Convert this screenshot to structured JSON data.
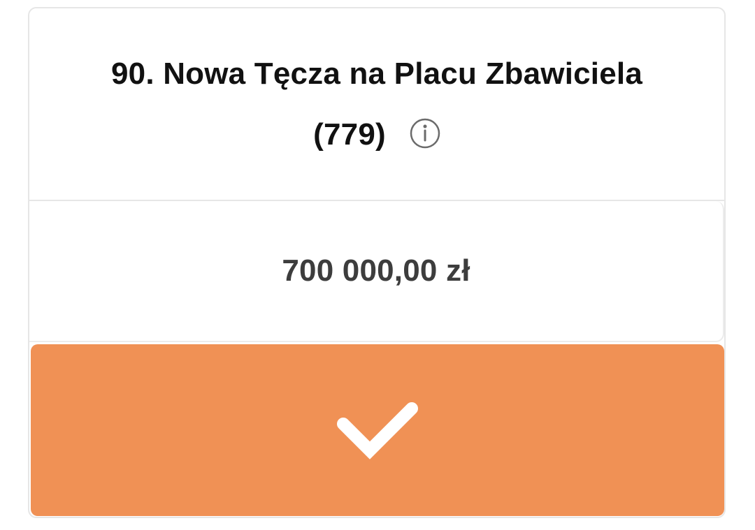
{
  "project": {
    "title": "90. Nowa Tęcza na Placu Zbawiciela (779)",
    "info_icon": "info-circle-icon",
    "amount": "700 000,00 zł"
  },
  "action": {
    "icon": "checkmark-icon",
    "color": "#f09155"
  },
  "colors": {
    "title": "#111111",
    "amount": "#3d3d3d",
    "border": "#e6e6e6",
    "icon": "#6b6b6b"
  }
}
